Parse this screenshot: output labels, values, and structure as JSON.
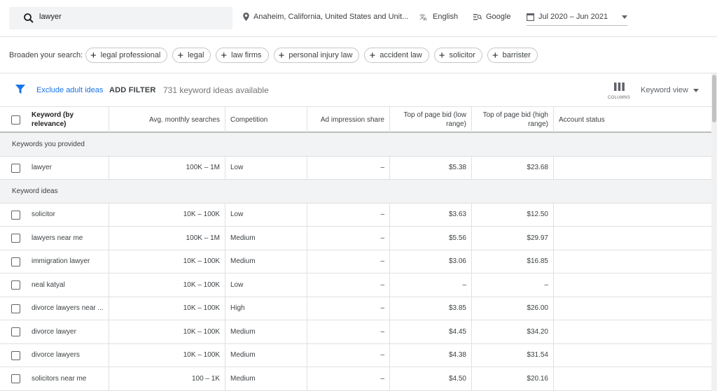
{
  "topbar": {
    "search_value": "lawyer",
    "location": "Anaheim, California, United States and Unit...",
    "language": "English",
    "network": "Google",
    "date_range": "Jul 2020 – Jun 2021"
  },
  "broaden": {
    "label": "Broaden your search:",
    "chips": [
      "legal professional",
      "legal",
      "law firms",
      "personal injury law",
      "accident law",
      "solicitor",
      "barrister"
    ]
  },
  "filterbar": {
    "exclude_label": "Exclude adult ideas",
    "add_filter_label": "ADD FILTER",
    "count_text": "731 keyword ideas available",
    "columns_label": "COLUMNS",
    "view_label": "Keyword view"
  },
  "table": {
    "headers": {
      "keyword": "Keyword (by relevance)",
      "avg": "Avg. monthly searches",
      "competition": "Competition",
      "impression": "Ad impression share",
      "bid_low": "Top of page bid (low range)",
      "bid_high": "Top of page bid (high range)",
      "account": "Account status"
    },
    "group_provided": "Keywords you provided",
    "provided_rows": [
      {
        "keyword": "lawyer",
        "avg": "100K – 1M",
        "competition": "Low",
        "impression": "–",
        "bid_low": "$5.38",
        "bid_high": "$23.68"
      }
    ],
    "group_ideas": "Keyword ideas",
    "idea_rows": [
      {
        "keyword": "solicitor",
        "avg": "10K – 100K",
        "competition": "Low",
        "impression": "–",
        "bid_low": "$3.63",
        "bid_high": "$12.50"
      },
      {
        "keyword": "lawyers near me",
        "avg": "100K – 1M",
        "competition": "Medium",
        "impression": "–",
        "bid_low": "$5.56",
        "bid_high": "$29.97"
      },
      {
        "keyword": "immigration lawyer",
        "avg": "10K – 100K",
        "competition": "Medium",
        "impression": "–",
        "bid_low": "$3.06",
        "bid_high": "$16.85"
      },
      {
        "keyword": "neal katyal",
        "avg": "10K – 100K",
        "competition": "Low",
        "impression": "–",
        "bid_low": "–",
        "bid_high": "–"
      },
      {
        "keyword": "divorce lawyers near ...",
        "avg": "10K – 100K",
        "competition": "High",
        "impression": "–",
        "bid_low": "$3.85",
        "bid_high": "$26.00"
      },
      {
        "keyword": "divorce lawyer",
        "avg": "10K – 100K",
        "competition": "Medium",
        "impression": "–",
        "bid_low": "$4.45",
        "bid_high": "$34.20"
      },
      {
        "keyword": "divorce lawyers",
        "avg": "10K – 100K",
        "competition": "Medium",
        "impression": "–",
        "bid_low": "$4.38",
        "bid_high": "$31.54"
      },
      {
        "keyword": "solicitors near me",
        "avg": "100 – 1K",
        "competition": "Medium",
        "impression": "–",
        "bid_low": "$4.50",
        "bid_high": "$20.16"
      }
    ]
  },
  "colors": {
    "accent": "#1a73e8",
    "group_bg": "#f1f3f4"
  }
}
